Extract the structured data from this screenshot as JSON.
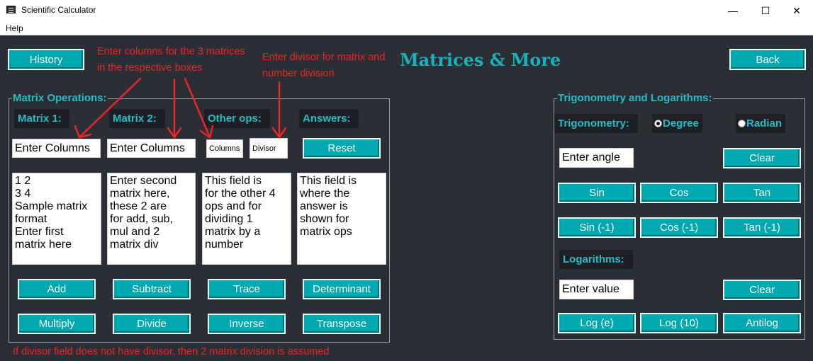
{
  "window": {
    "title": "Scientific Calculator",
    "minimize": "—",
    "maximize": "☐",
    "close": "✕"
  },
  "menu": {
    "help": "Help"
  },
  "header": {
    "history": "History",
    "title": "Matrices & More",
    "back": "Back"
  },
  "annotations": {
    "columns_line1": "Enter columns for the 3 matrices",
    "columns_line2": "in the respective boxes",
    "divisor_line1": "Enter divisor for matrix and",
    "divisor_line2": "number division",
    "footer": "If divisor field does not have divisor, then 2 matrix division is assumed"
  },
  "matrix_ops": {
    "group_label": "Matrix Operations:",
    "matrix1_label": "Matrix 1:",
    "matrix2_label": "Matrix 2:",
    "other_label": "Other ops:",
    "answers_label": "Answers:",
    "matrix1_columns": "Enter Columns",
    "matrix2_columns": "Enter Columns",
    "other_columns": "Columns",
    "divisor": "Divisor",
    "reset": "Reset",
    "matrix1_text": "1 2\n3 4\nSample matrix\nformat\nEnter first\nmatrix here",
    "matrix2_text": "Enter second\nmatrix here,\nthese 2 are\nfor add, sub,\nmul and 2\nmatrix div",
    "other_text": "This field is\nfor the other 4\nops and for\ndividing 1\nmatrix by a\nnumber",
    "answer_text": "This field is\nwhere the\nanswer is\nshown for\nmatrix ops",
    "buttons": {
      "add": "Add",
      "subtract": "Subtract",
      "trace": "Trace",
      "determinant": "Determinant",
      "multiply": "Multiply",
      "divide": "Divide",
      "inverse": "Inverse",
      "transpose": "Transpose"
    }
  },
  "trig_log": {
    "group_label": "Trigonometry and Logarithms:",
    "trig_label": "Trigonometry:",
    "degree": "Degree",
    "radian": "Radian",
    "angle_input": "Enter angle",
    "clear_angle": "Clear",
    "sin": "Sin",
    "cos": "Cos",
    "tan": "Tan",
    "asin": "Sin (-1)",
    "acos": "Cos (-1)",
    "atan": "Tan (-1)",
    "log_label": "Logarithms:",
    "value_input": "Enter value",
    "clear_value": "Clear",
    "ln": "Log (e)",
    "log10": "Log (10)",
    "antilog": "Antilog"
  },
  "colors": {
    "accent": "#00a8b0",
    "background": "#2b2e35",
    "annotation": "#e8262a",
    "label_text": "#26bcc4"
  }
}
